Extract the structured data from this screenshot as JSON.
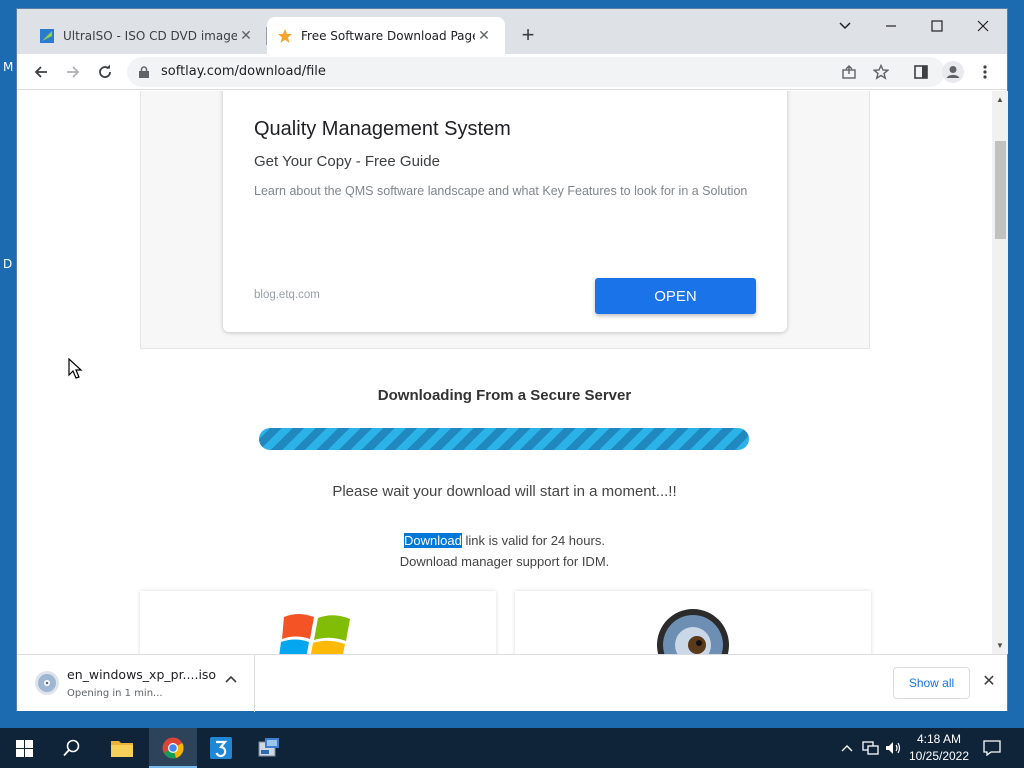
{
  "desktop": {
    "left_letters": [
      "M",
      "D"
    ]
  },
  "browser": {
    "tabs": [
      {
        "title": "UltraISO - ISO CD DVD image cre",
        "active": false
      },
      {
        "title": "Free Software Download Page - S",
        "active": true
      }
    ],
    "url": "softlay.com/download/file"
  },
  "ad": {
    "title": "Quality Management System",
    "subtitle": "Get Your Copy - Free Guide",
    "description": "Learn about the QMS software landscape and what Key Features to look for in a Solution",
    "domain": "blog.etq.com",
    "button": "OPEN"
  },
  "download_page": {
    "heading": "Downloading From a Secure Server",
    "progress": 1.0,
    "wait_text": "Please wait your download will start in a moment...!!",
    "selected_word": "Download",
    "validity_text": " link is valid for 24 hours.",
    "idm_text": "Download manager support for IDM."
  },
  "download_shelf": {
    "filename": "en_windows_xp_pr....iso",
    "status": "Opening in 1 min...",
    "show_all": "Show all"
  },
  "taskbar": {
    "time": "4:18 AM",
    "date": "10/25/2022"
  },
  "colors": {
    "accent_blue": "#1a73e8",
    "progress_blue": "#1ea0d6",
    "desktop_blue": "#1c6ab0",
    "taskbar": "#0f2438"
  }
}
